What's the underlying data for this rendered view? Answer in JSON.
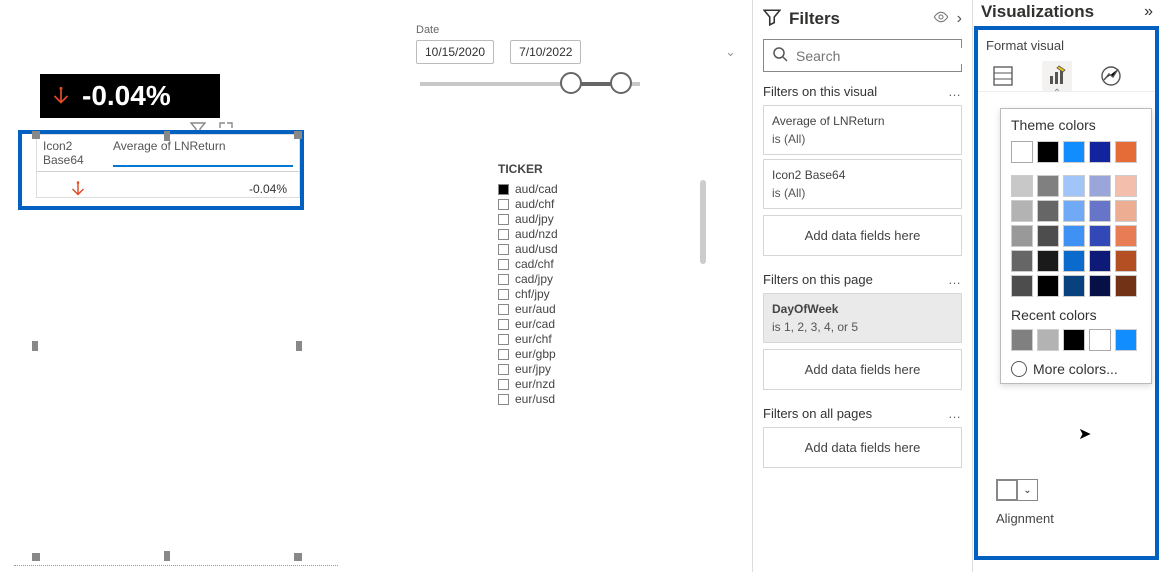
{
  "canvas": {
    "kpi": {
      "value": "-0.04%",
      "icon": "down-arrow-icon",
      "iconColor": "#e04b2a"
    },
    "table": {
      "col1": "Icon2 Base64",
      "col2": "Average of LNReturn",
      "row_icon": "down-arrow-icon",
      "row_val": "-0.04%"
    },
    "dateSlicer": {
      "label": "Date",
      "start": "10/15/2020",
      "end": "7/10/2022"
    },
    "ticker": {
      "title": "TICKER",
      "items": [
        {
          "label": "aud/cad",
          "checked": true
        },
        {
          "label": "aud/chf",
          "checked": false
        },
        {
          "label": "aud/jpy",
          "checked": false
        },
        {
          "label": "aud/nzd",
          "checked": false
        },
        {
          "label": "aud/usd",
          "checked": false
        },
        {
          "label": "cad/chf",
          "checked": false
        },
        {
          "label": "cad/jpy",
          "checked": false
        },
        {
          "label": "chf/jpy",
          "checked": false
        },
        {
          "label": "eur/aud",
          "checked": false
        },
        {
          "label": "eur/cad",
          "checked": false
        },
        {
          "label": "eur/chf",
          "checked": false
        },
        {
          "label": "eur/gbp",
          "checked": false
        },
        {
          "label": "eur/jpy",
          "checked": false
        },
        {
          "label": "eur/nzd",
          "checked": false
        },
        {
          "label": "eur/usd",
          "checked": false
        }
      ]
    }
  },
  "filters": {
    "title": "Filters",
    "search_placeholder": "Search",
    "sections": {
      "visual": {
        "head": "Filters on this visual",
        "cards": [
          {
            "label": "Average of LNReturn",
            "val": "is (All)"
          },
          {
            "label": "Icon2 Base64",
            "val": "is (All)"
          }
        ],
        "add": "Add data fields here"
      },
      "page": {
        "head": "Filters on this page",
        "cards": [
          {
            "label": "DayOfWeek",
            "val": "is 1, 2, 3, 4, or 5"
          }
        ],
        "add": "Add data fields here"
      },
      "all": {
        "head": "Filters on all pages",
        "add": "Add data fields here"
      }
    }
  },
  "viz": {
    "title": "Visualizations",
    "subtitle": "Format visual",
    "colorPop": {
      "themeTitle": "Theme colors",
      "recentTitle": "Recent colors",
      "more": "More colors...",
      "alignment": "Alignment",
      "theme": [
        [
          "#ffffff",
          "#000000",
          "#118dff",
          "#12239e",
          "#e66c37"
        ],
        [
          "#c8c8c8",
          "#808080",
          "#a2c5f9",
          "#9aa6d9",
          "#f3beab"
        ],
        [
          "#b3b3b3",
          "#666666",
          "#70a9f6",
          "#6675c8",
          "#edad92"
        ],
        [
          "#999999",
          "#4d4d4d",
          "#3f92f4",
          "#3348b7",
          "#e77c55"
        ],
        [
          "#666666",
          "#1a1a1a",
          "#0b6bcc",
          "#0d1a77",
          "#b44f23"
        ],
        [
          "#4d4d4d",
          "#000000",
          "#07427e",
          "#070f47",
          "#723216"
        ]
      ],
      "recent": [
        "#808080",
        "#b3b3b3",
        "#000000",
        "#ffffff",
        "#118dff"
      ]
    }
  }
}
